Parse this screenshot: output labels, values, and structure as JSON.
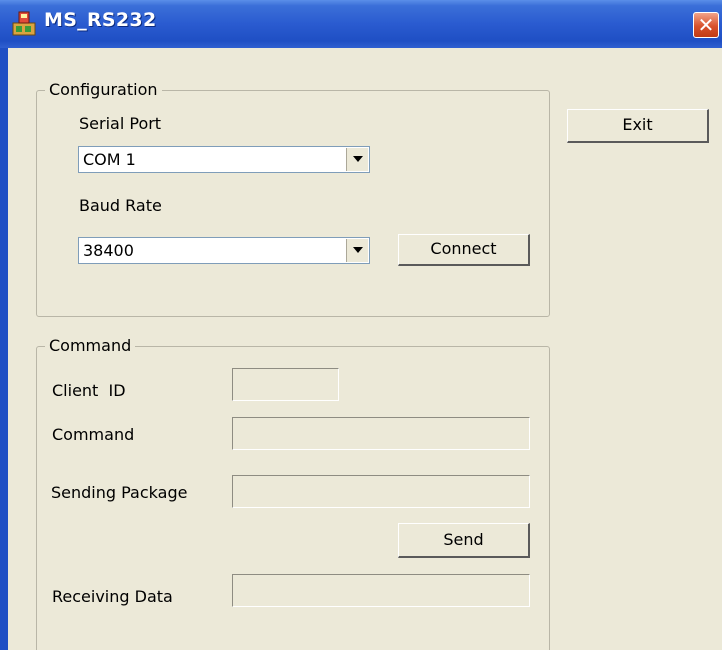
{
  "window": {
    "title": "MS_RS232",
    "close_label": "✕"
  },
  "configuration": {
    "legend": "Configuration",
    "serial_port_label": "Serial Port",
    "serial_port_value": "COM 1",
    "baud_rate_label": "Baud Rate",
    "baud_rate_value": "38400",
    "connect_label": "Connect"
  },
  "exit_label": "Exit",
  "command": {
    "legend": "Command",
    "client_id_label": "Client  ID",
    "client_id_value": "",
    "command_label": "Command",
    "command_value": "",
    "sending_package_label": "Sending Package",
    "sending_package_value": "",
    "send_label": "Send",
    "receiving_data_label": "Receiving Data",
    "receiving_data_value": ""
  },
  "colors": {
    "title_bar": "#2a5bd0",
    "dialog_bg": "#ece9d8",
    "close_button": "#d8522d"
  }
}
